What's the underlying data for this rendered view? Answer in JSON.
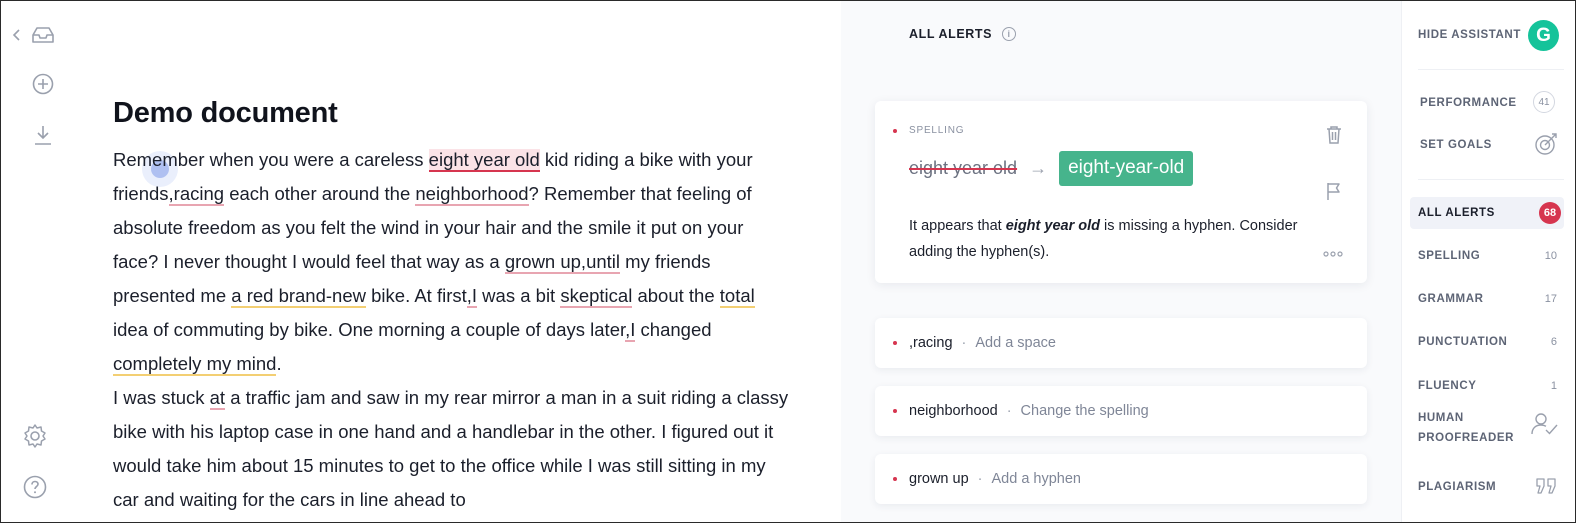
{
  "document": {
    "title": "Demo document",
    "p1": {
      "s1": "Remember when you were a careless ",
      "w1": "eight year old",
      "s2": " kid riding a bike with your friends",
      "w2": ",racing",
      "s3": " each other around the ",
      "w3": "neighborhood",
      "s4": "? Remember that feeling of absolute freedom as you felt the wind in your hair and the smile it put on your face? I never thought I would feel that way as a ",
      "w4": "grown up,until",
      "s5": " my friends presented me ",
      "w5": "a red brand-new",
      "s6": " bike. At first",
      "w6": ",I",
      "s7": " was a bit ",
      "w7": "skeptical",
      "s8": " about the ",
      "w8": "total",
      "s9": " idea of commuting by bike. One morning a couple of days later",
      "w9": ",I",
      "s10": " changed ",
      "w10": "completely my mind",
      "s11": "."
    },
    "p2": {
      "s1": "I was stuck ",
      "w1": "at",
      "s2": " a traffic jam and saw in my rear mirror a man in a suit riding a classy bike with his laptop case in one hand and a handlebar in the other. I figured out it would take him about 15 minutes to get to the office while I was still sitting in my car and waiting for the cars in line ahead to"
    }
  },
  "alerts": {
    "header": "ALL ALERTS",
    "main_card": {
      "category": "SPELLING",
      "original": "eight year old",
      "suggestion": "eight-year-old",
      "explanation_pre": "It appears that ",
      "explanation_bold": "eight year old",
      "explanation_post": " is missing a hyphen. Consider adding the hyphen(s)."
    },
    "cards": [
      {
        "word": ",racing",
        "action": "Add a space"
      },
      {
        "word": "neighborhood",
        "action": "Change the spelling"
      },
      {
        "word": "grown up",
        "action": "Add a hyphen"
      }
    ]
  },
  "sidebar": {
    "hide_assistant": "HIDE ASSISTANT",
    "logo_letter": "G",
    "performance": {
      "label": "PERFORMANCE",
      "count": "41"
    },
    "set_goals": "SET GOALS",
    "items": [
      {
        "label": "ALL ALERTS",
        "count": "68"
      },
      {
        "label": "SPELLING",
        "count": "10"
      },
      {
        "label": "GRAMMAR",
        "count": "17"
      },
      {
        "label": "PUNCTUATION",
        "count": "6"
      },
      {
        "label": "FLUENCY",
        "count": "1"
      }
    ],
    "human_proofreader_1": "HUMAN",
    "human_proofreader_2": "PROOFREADER",
    "plagiarism": "PLAGIARISM"
  },
  "colors": {
    "accent_green": "#15c39a",
    "suggestion_green": "#46b48c",
    "alert_red": "#d6354f",
    "underline_yellow": "#f3cf73"
  },
  "icons": [
    "chevron-left-icon",
    "inbox-icon",
    "plus-circle-icon",
    "download-icon",
    "settings-icon",
    "help-icon",
    "info-icon",
    "trash-icon",
    "flag-icon",
    "more-icon",
    "target-icon",
    "user-check-icon",
    "quote-icon"
  ]
}
